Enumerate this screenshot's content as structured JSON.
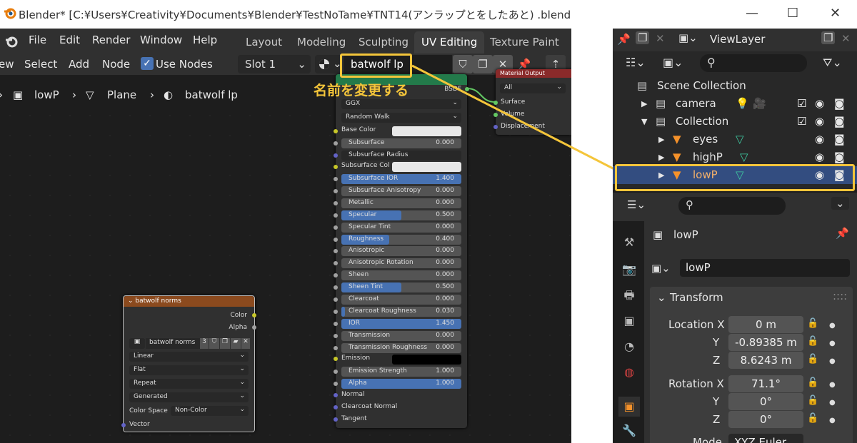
{
  "left_window": {
    "title": "Blender* [C:¥Users¥Creativity¥Documents¥Blender¥TestNoTame¥TNT14(アンラップとをしたあと) .blend]",
    "menu": [
      "File",
      "Edit",
      "Render",
      "Window",
      "Help"
    ],
    "workspaces": [
      "Layout",
      "Modeling",
      "Sculpting",
      "UV Editing",
      "Texture Paint"
    ],
    "active_workspace": "UV Editing",
    "header": {
      "view": "ew",
      "select": "Select",
      "add": "Add",
      "node": "Node",
      "use_nodes_label": "Use Nodes",
      "slot": "Slot 1",
      "material_name": "batwolf lp"
    },
    "breadcrumb": {
      "object": "lowP",
      "mesh": "Plane",
      "material": "batwolf lp"
    },
    "annotation": "名前を変更する",
    "bsdf_node": {
      "bsdf_label": "BSDF",
      "distribution": "GGX",
      "subsurface_method": "Random Walk",
      "base_color_label": "Base Color",
      "subsurface_col_label": "Subsurface Col",
      "rows": [
        {
          "label": "Subsurface",
          "value": "0.000",
          "fill": 0
        },
        {
          "label": "Subsurface Radius",
          "value": "",
          "fill": 0
        },
        {
          "label": "Subsurface IOR",
          "value": "1.400",
          "fill": 1
        },
        {
          "label": "Subsurface Anisotropy",
          "value": "0.000",
          "fill": 0
        },
        {
          "label": "Metallic",
          "value": "0.000",
          "fill": 0
        },
        {
          "label": "Specular",
          "value": "0.500",
          "fill": 0.5
        },
        {
          "label": "Specular Tint",
          "value": "0.000",
          "fill": 0
        },
        {
          "label": "Roughness",
          "value": "0.400",
          "fill": 0.4
        },
        {
          "label": "Anisotropic",
          "value": "0.000",
          "fill": 0
        },
        {
          "label": "Anisotropic Rotation",
          "value": "0.000",
          "fill": 0
        },
        {
          "label": "Sheen",
          "value": "0.000",
          "fill": 0
        },
        {
          "label": "Sheen Tint",
          "value": "0.500",
          "fill": 0.5
        },
        {
          "label": "Clearcoat",
          "value": "0.000",
          "fill": 0
        },
        {
          "label": "Clearcoat Roughness",
          "value": "0.030",
          "fill": 0.03
        },
        {
          "label": "IOR",
          "value": "1.450",
          "fill": 1
        },
        {
          "label": "Transmission",
          "value": "0.000",
          "fill": 0
        },
        {
          "label": "Transmission Roughness",
          "value": "0.000",
          "fill": 0
        }
      ],
      "emission_label": "Emission",
      "emission_strength": {
        "label": "Emission Strength",
        "value": "1.000",
        "fill": 0
      },
      "alpha": {
        "label": "Alpha",
        "value": "1.000",
        "fill": 1
      },
      "normal_label": "Normal",
      "clearcoat_normal_label": "Clearcoat Normal",
      "tangent_label": "Tangent"
    },
    "output_node": {
      "title": "Material Output",
      "target": "All",
      "sockets": [
        "Surface",
        "Volume",
        "Displacement"
      ]
    },
    "image_node": {
      "title": "batwolf norms",
      "out_color": "Color",
      "out_alpha": "Alpha",
      "image_name": "batwolf norms",
      "users": "3",
      "interpolation": "Linear",
      "projection": "Flat",
      "extension": "Repeat",
      "source": "Generated",
      "color_space_label": "Color Space",
      "color_space": "Non-Color",
      "vector_label": "Vector"
    }
  },
  "right_window": {
    "view_layer": "ViewLayer",
    "outliner": [
      {
        "name": "Scene Collection",
        "level": 0
      },
      {
        "name": "camera",
        "level": 1
      },
      {
        "name": "Collection",
        "level": 1
      },
      {
        "name": "eyes",
        "level": 2
      },
      {
        "name": "highP",
        "level": 2
      },
      {
        "name": "lowP",
        "level": 2,
        "selected": true
      }
    ],
    "properties": {
      "object_name": "lowP",
      "data_name": "lowP",
      "panel_title": "Transform",
      "location_label": "Location X",
      "location": [
        "0 m",
        "-0.89385 m",
        "8.6243 m"
      ],
      "rotation_label": "Rotation X",
      "rotation": [
        "71.1°",
        "0°",
        "0°"
      ],
      "axis_y": "Y",
      "axis_z": "Z",
      "mode_label": "Mode",
      "mode_value": "XYZ Euler"
    }
  }
}
